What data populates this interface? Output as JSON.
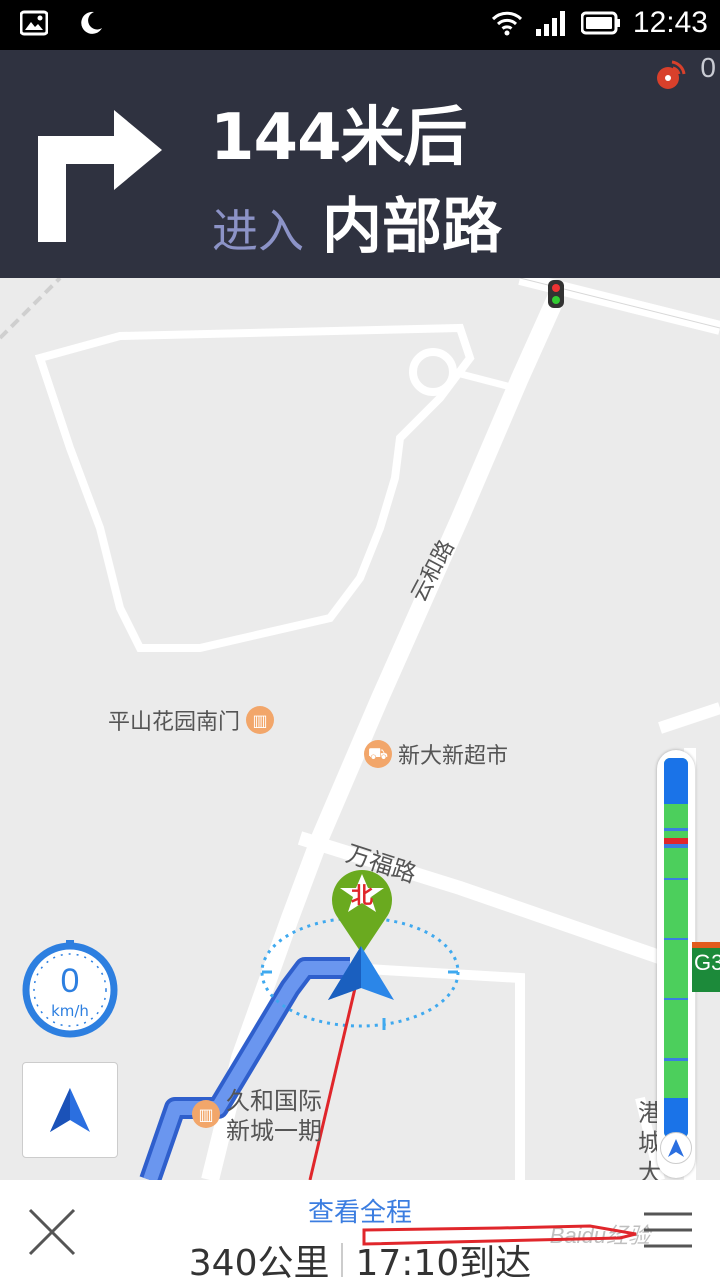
{
  "status_bar": {
    "time": "12:43",
    "left_icons": [
      "image-icon",
      "moon-icon"
    ],
    "right_icons": [
      "wifi-icon",
      "cell-signal-icon",
      "battery-icon"
    ]
  },
  "guidance": {
    "distance": "144米后",
    "road_prefix": "进入",
    "road_name": "内部路",
    "turn_icon": "turn-right-arrow-icon",
    "signal_count": "0"
  },
  "map": {
    "road_labels": {
      "yunhe": "云和路",
      "wanfu": "万福路",
      "side": "港城大"
    },
    "pois": [
      {
        "name": "平山花园南门",
        "icon": "building-icon"
      },
      {
        "name": "新大新超市",
        "icon": "shopping-cart-icon"
      },
      {
        "name": "久和国际新城一期",
        "icon": "building-icon"
      }
    ],
    "north_marker": "北",
    "speed": {
      "value": "0",
      "unit": "km/h"
    },
    "highway_badge": "G3"
  },
  "bottom_bar": {
    "view_full_route": "查看全程",
    "distance": "340公里",
    "arrival": "17:10到达",
    "watermark": "Baidu经验"
  },
  "colors": {
    "header_bg": "#2f3240",
    "route_blue": "#4a78e0",
    "accent_blue": "#3b7de0",
    "traffic_green": "#4ccf5c",
    "marker_green": "#6aaa1f",
    "annotation_red": "#e0262b"
  }
}
